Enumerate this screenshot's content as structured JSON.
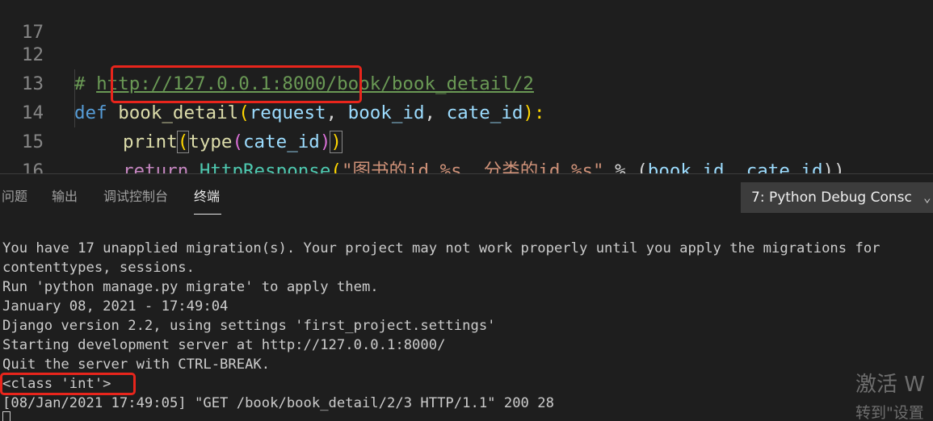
{
  "editor": {
    "lines": [
      {
        "num": "12",
        "comment_prefix": "# ",
        "url": "http://127.0.0.1:8000/book/book_detail/2"
      },
      {
        "num": "13",
        "kw": "def",
        "fn": "book_detail",
        "open": "(",
        "p1": "request",
        "c1": ", ",
        "p2": "book_id",
        "c2": ", ",
        "p3": "cate_id",
        "close": "):"
      },
      {
        "num": "14",
        "fn1": "print",
        "open1": "(",
        "fn2": "type",
        "open2": "(",
        "arg": "cate_id",
        "close2": ")",
        "close1": ")"
      },
      {
        "num": "15",
        "kw": "return",
        "cls": "HttpResponse",
        "open": "(",
        "str": "\"图书的id %s, 分类的id %s\"",
        "op": " % (",
        "a1": "book_id",
        "sep": ", ",
        "a2": "cate_id",
        "close": "))"
      },
      {
        "num": "16"
      },
      {
        "num": "17"
      }
    ]
  },
  "panel": {
    "tabs": [
      "问题",
      "输出",
      "调试控制台",
      "终端"
    ],
    "active_tab": "终端",
    "terminal_selector": "7: Python Debug Consc",
    "terminal_lines": [
      "You have 17 unapplied migration(s). Your project may not work properly until you apply the migrations for",
      "contenttypes, sessions.",
      "Run 'python manage.py migrate' to apply them.",
      "January 08, 2021 - 17:49:04",
      "Django version 2.2, using settings 'first_project.settings'",
      "Starting development server at http://127.0.0.1:8000/",
      "Quit the server with CTRL-BREAK.",
      "<class 'int'>",
      "[08/Jan/2021 17:49:05] \"GET /book/book_detail/2/3 HTTP/1.1\" 200 28"
    ]
  },
  "watermark": {
    "line1": "激活 W",
    "line2": "转到\"设置"
  },
  "colors": {
    "background": "#1e1e1e",
    "highlight_box": "#e8251c",
    "keyword": "#569cd6",
    "function": "#dcdcaa",
    "class": "#4ec9b0",
    "parameter": "#9cdcfe",
    "string": "#ce9178",
    "comment": "#6a9955"
  }
}
